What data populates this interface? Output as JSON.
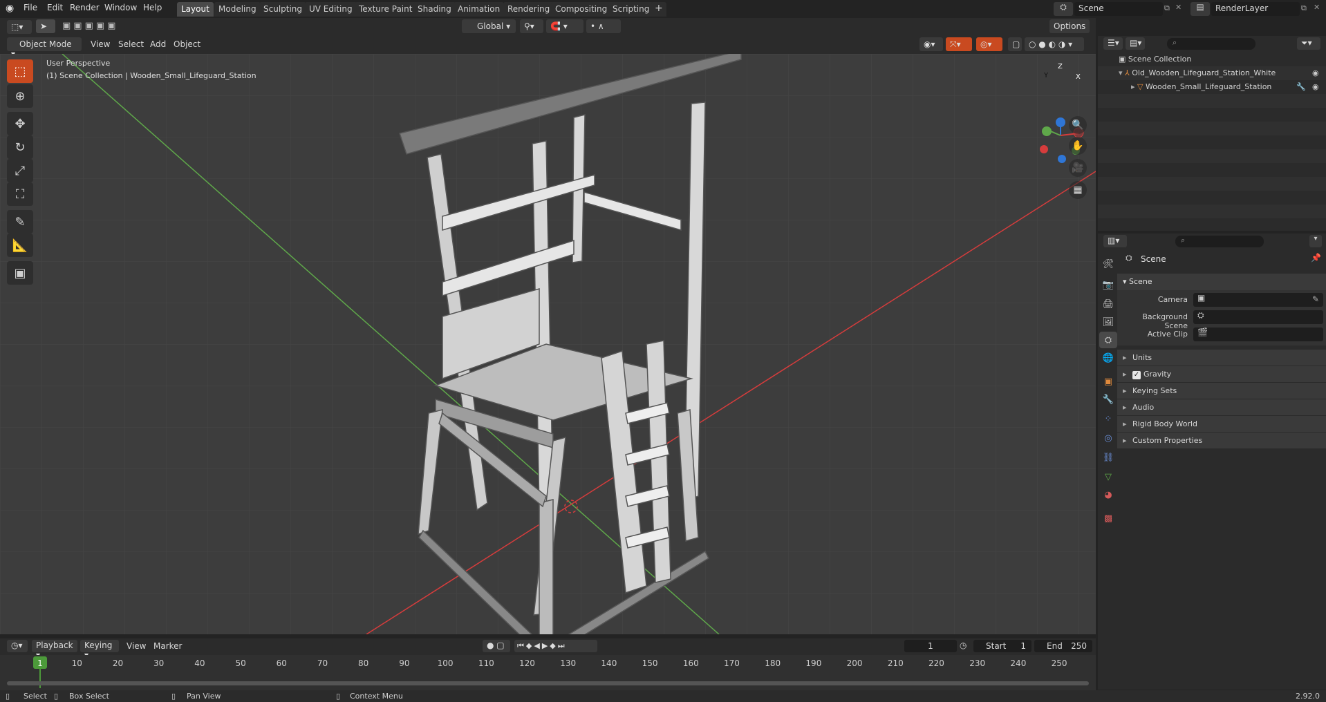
{
  "app": {
    "logo_icon": "blender-logo-icon",
    "menus": [
      "File",
      "Edit",
      "Render",
      "Window",
      "Help"
    ],
    "workspace_tabs": [
      "Layout",
      "Modeling",
      "Sculpting",
      "UV Editing",
      "Texture Paint",
      "Shading",
      "Animation",
      "Rendering",
      "Compositing",
      "Scripting"
    ],
    "active_tab": "Layout",
    "add_tab_label": "+",
    "scene_name": "Scene",
    "render_layer": "RenderLayer"
  },
  "viewport_header": {
    "mode": "Object Mode",
    "menus": [
      "View",
      "Select",
      "Add",
      "Object"
    ],
    "transform_orientation": "Global",
    "options_label": "Options"
  },
  "viewport": {
    "perspective_label": "User Perspective",
    "collection_label": "(1) Scene Collection | Wooden_Small_Lifeguard_Station",
    "gizmo_axes": [
      "X",
      "Y",
      "Z"
    ],
    "colors": {
      "x_axis": "#d63c3c",
      "y_axis": "#5fa84a",
      "z_axis": "#2f76d6",
      "active_tool": "#c94a20"
    }
  },
  "outliner": {
    "root": "Scene Collection",
    "items": [
      {
        "label": "Old_Wooden_Lifeguard_Station_White",
        "icon": "empty-icon"
      },
      {
        "label": "Wooden_Small_Lifeguard_Station",
        "icon": "mesh-icon"
      }
    ]
  },
  "properties": {
    "header": "Scene",
    "panel_title": "Scene",
    "fields": [
      {
        "label": "Camera"
      },
      {
        "label": "Background Scene"
      },
      {
        "label": "Active Clip"
      }
    ],
    "subpanels": [
      "Units",
      "Gravity",
      "Keying Sets",
      "Audio",
      "Rigid Body World",
      "Custom Properties"
    ],
    "gravity_checked": true
  },
  "timeline": {
    "menus": [
      "Playback",
      "Keying",
      "View",
      "Marker"
    ],
    "current_frame": "1",
    "start_label": "Start",
    "start_value": "1",
    "end_label": "End",
    "end_value": "250",
    "ticks": [
      "1",
      "10",
      "20",
      "30",
      "40",
      "50",
      "60",
      "70",
      "80",
      "90",
      "100",
      "110",
      "120",
      "130",
      "140",
      "150",
      "160",
      "170",
      "180",
      "190",
      "200",
      "210",
      "220",
      "230",
      "240",
      "250"
    ]
  },
  "statusbar": {
    "items": [
      "Select",
      "Box Select",
      "Pan View",
      "Context Menu"
    ],
    "version": "2.92.0"
  }
}
